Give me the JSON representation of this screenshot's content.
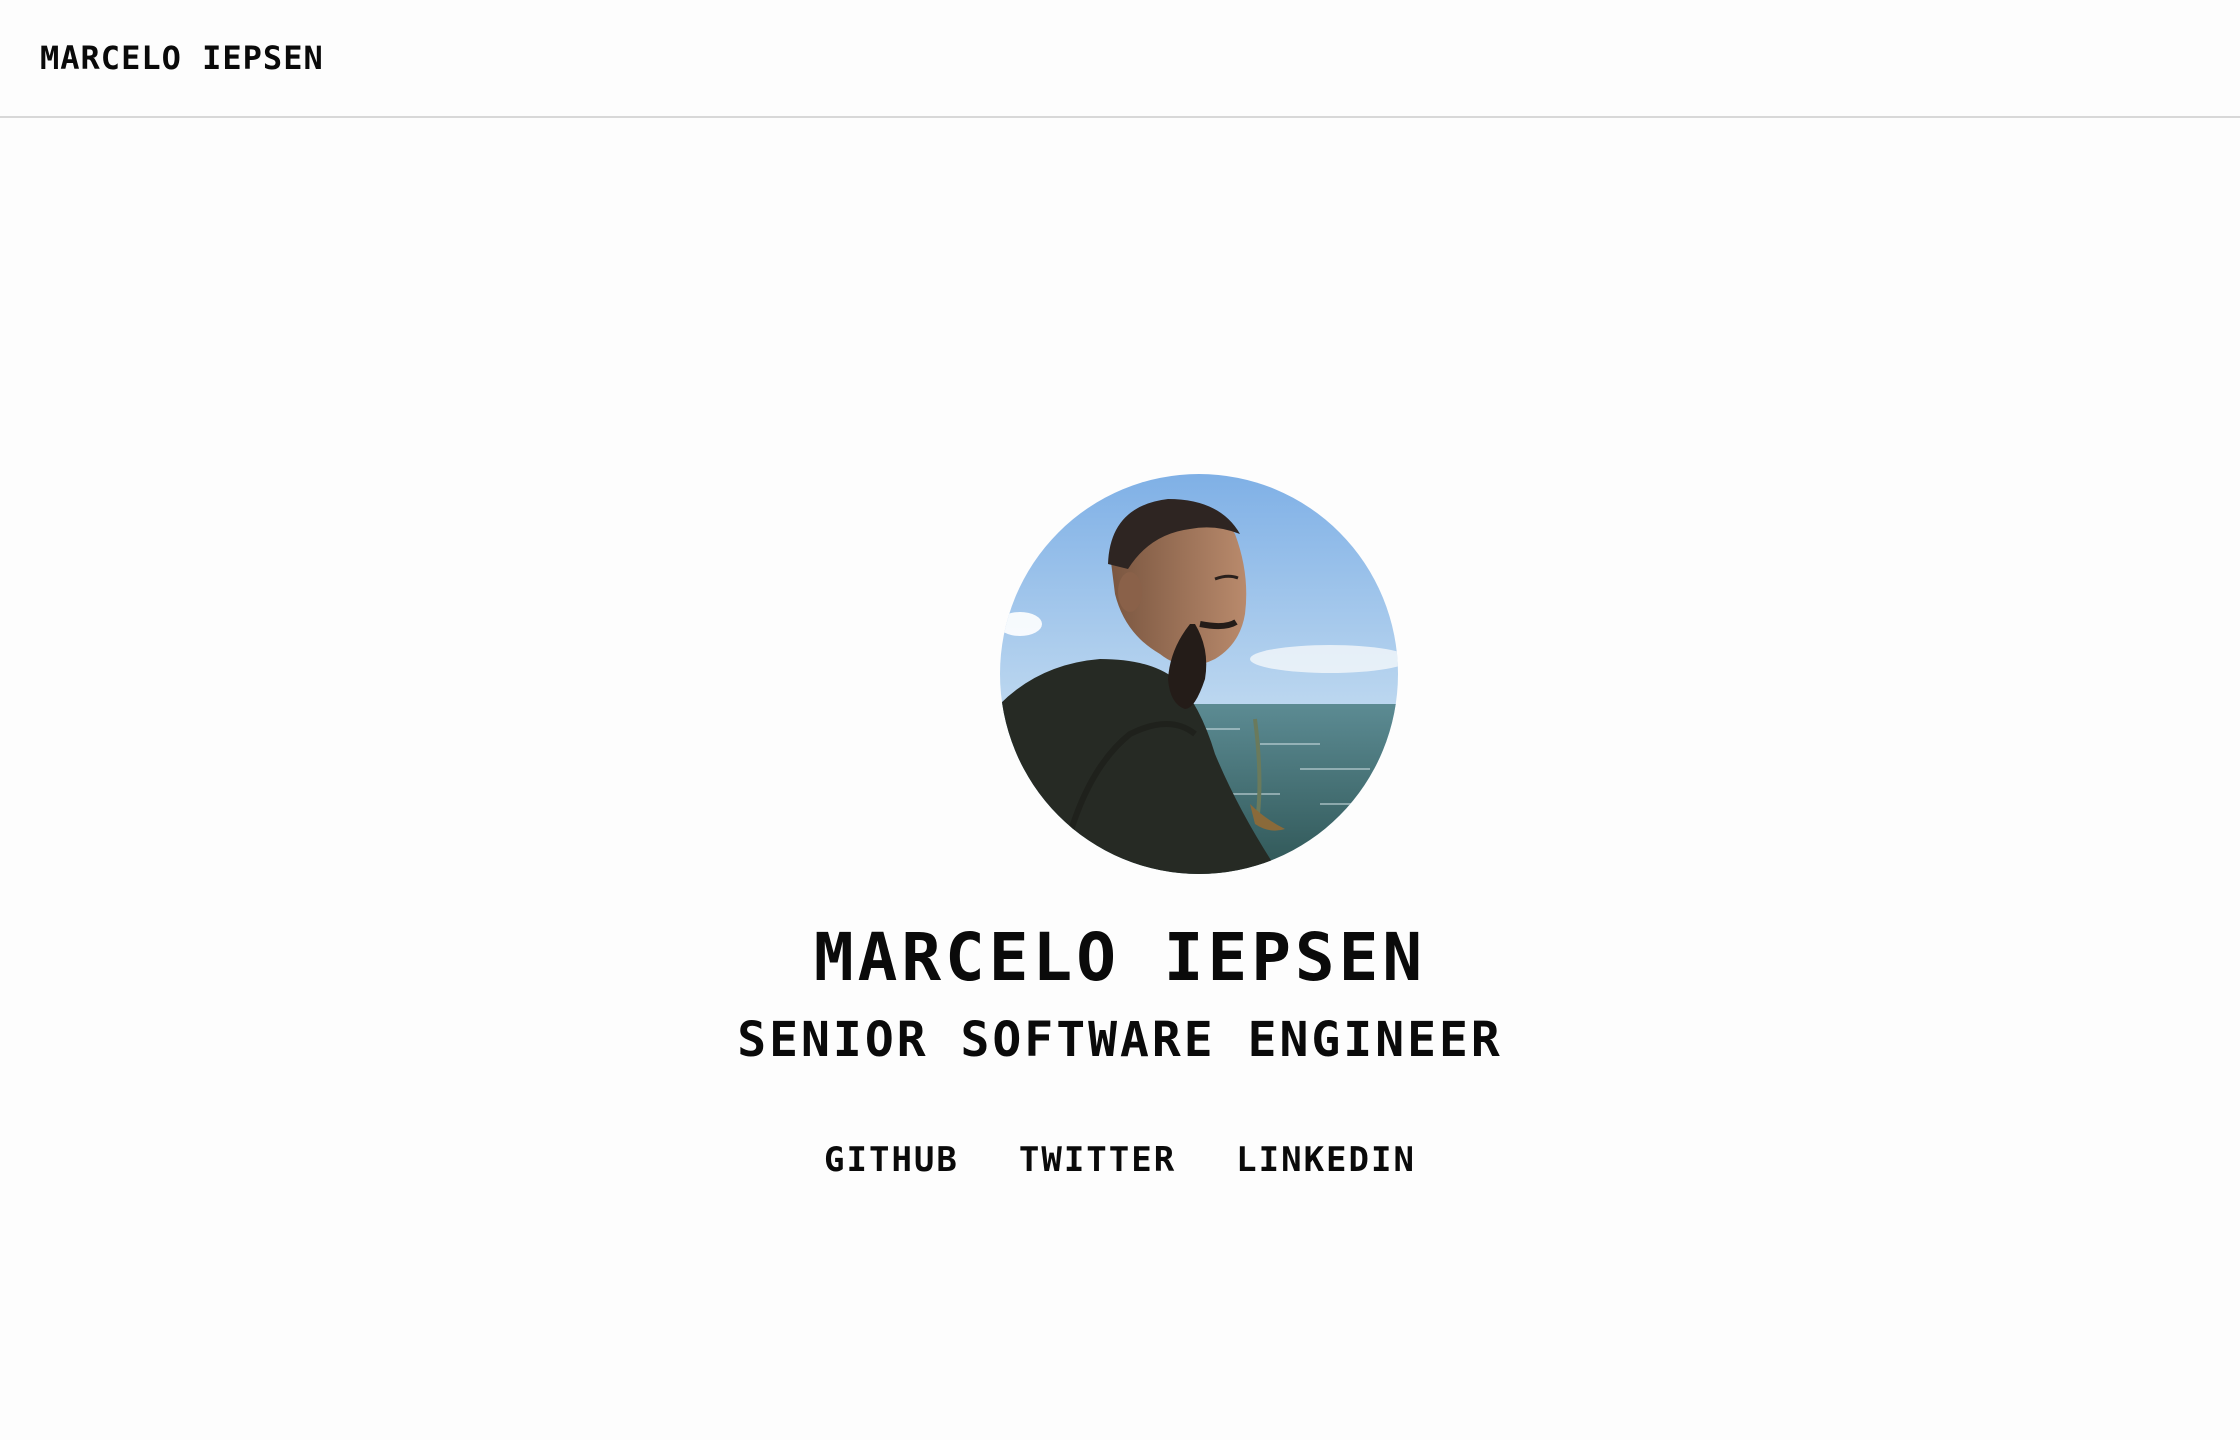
{
  "header": {
    "brand": "MARCELO IEPSEN"
  },
  "hero": {
    "avatar_alt": "Portrait photo of Marcelo Iepsen by the sea",
    "name": "MARCELO IEPSEN",
    "role": "SENIOR SOFTWARE ENGINEER"
  },
  "links": [
    {
      "label": "GITHUB"
    },
    {
      "label": "TWITTER"
    },
    {
      "label": "LINKEDIN"
    }
  ]
}
